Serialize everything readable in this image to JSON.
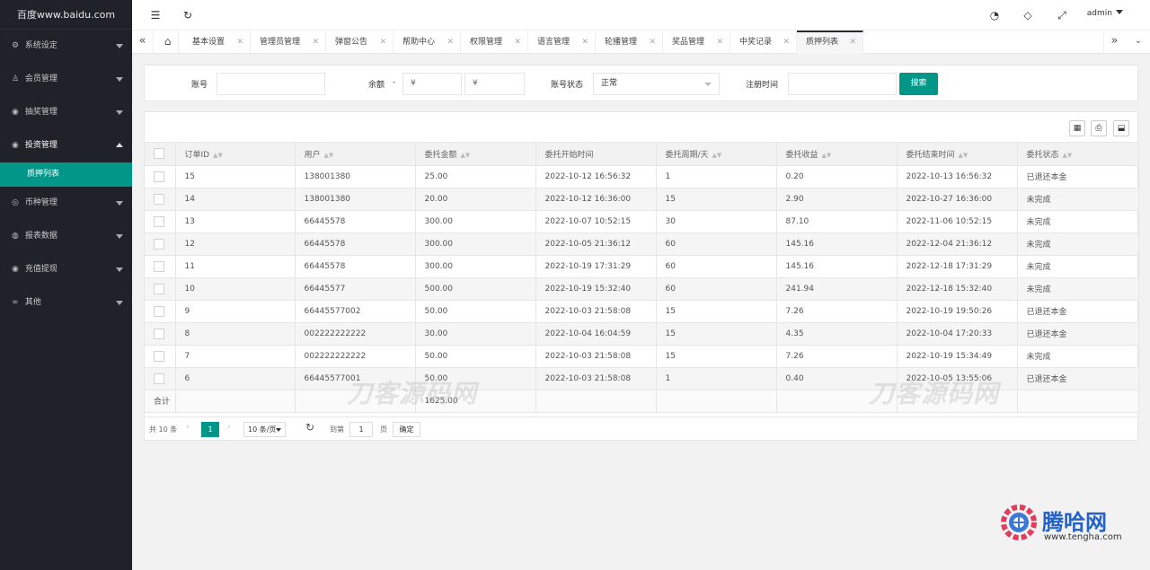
{
  "sidebar": {
    "logo": "百度www.baidu.com",
    "items": [
      {
        "label": "系统设定",
        "icon": "gear-icon"
      },
      {
        "label": "会员管理",
        "icon": "user-icon"
      },
      {
        "label": "抽奖管理",
        "icon": "circle-icon"
      },
      {
        "label": "投资管理",
        "icon": "circle-icon"
      },
      {
        "label": "币种管理",
        "icon": "coin-icon"
      },
      {
        "label": "报表数据",
        "icon": "report-icon"
      },
      {
        "label": "充值提现",
        "icon": "money-icon"
      },
      {
        "label": "其他",
        "icon": "infinity-icon"
      }
    ],
    "submenu": {
      "label": "质押列表"
    }
  },
  "header": {
    "user": "admin"
  },
  "tabs": [
    {
      "label": "基本设置"
    },
    {
      "label": "管理员管理"
    },
    {
      "label": "弹窗公告"
    },
    {
      "label": "帮助中心"
    },
    {
      "label": "权限管理"
    },
    {
      "label": "语言管理"
    },
    {
      "label": "轮播管理"
    },
    {
      "label": "奖品管理"
    },
    {
      "label": "中奖记录"
    },
    {
      "label": "质押列表"
    }
  ],
  "search": {
    "account_label": "账号",
    "balance_label": "余额",
    "dash": "-",
    "min_placeholder": "¥",
    "max_placeholder": "¥",
    "status_label": "账号状态",
    "status_value": "正常",
    "register_label": "注册时间",
    "search_button": "搜索"
  },
  "table": {
    "columns": [
      "订单ID",
      "用户",
      "委托金额",
      "委托开始时间",
      "委托周期/天",
      "委托收益",
      "委托结束时间",
      "委托状态"
    ],
    "rows": [
      [
        "15",
        "138001380",
        "25.00",
        "2022-10-12 16:56:32",
        "1",
        "0.20",
        "2022-10-13 16:56:32",
        "已退还本金"
      ],
      [
        "14",
        "138001380",
        "20.00",
        "2022-10-12 16:36:00",
        "15",
        "2.90",
        "2022-10-27 16:36:00",
        "未完成"
      ],
      [
        "13",
        "66445578",
        "300.00",
        "2022-10-07 10:52:15",
        "30",
        "87.10",
        "2022-11-06 10:52:15",
        "未完成"
      ],
      [
        "12",
        "66445578",
        "300.00",
        "2022-10-05 21:36:12",
        "60",
        "145.16",
        "2022-12-04 21:36:12",
        "未完成"
      ],
      [
        "11",
        "66445578",
        "300.00",
        "2022-10-19 17:31:29",
        "60",
        "145.16",
        "2022-12-18 17:31:29",
        "未完成"
      ],
      [
        "10",
        "66445577",
        "500.00",
        "2022-10-19 15:32:40",
        "60",
        "241.94",
        "2022-12-18 15:32:40",
        "未完成"
      ],
      [
        "9",
        "66445577002",
        "50.00",
        "2022-10-03 21:58:08",
        "15",
        "7.26",
        "2022-10-19 19:50:26",
        "已退还本金"
      ],
      [
        "8",
        "002222222222",
        "30.00",
        "2022-10-04 16:04:59",
        "15",
        "4.35",
        "2022-10-04 17:20:33",
        "已退还本金"
      ],
      [
        "7",
        "002222222222",
        "50.00",
        "2022-10-03 21:58:08",
        "15",
        "7.26",
        "2022-10-19 15:34:49",
        "未完成"
      ],
      [
        "6",
        "66445577001",
        "50.00",
        "2022-10-03 21:58:08",
        "1",
        "0.40",
        "2022-10-05 13:55:06",
        "已退还本金"
      ]
    ],
    "sum_label": "合计",
    "sum_value": "1625.00"
  },
  "pager": {
    "total": "共 10 条",
    "current": "1",
    "page_size": "10 条/页",
    "goto_label": "到第",
    "goto_value": "1",
    "page_unit": "页",
    "confirm": "确定"
  },
  "watermark": "刀客源码网",
  "brand": {
    "name": "腾哈网",
    "url": "www.tengha.com",
    "color": "#2462c7"
  },
  "colors": {
    "accent": "#009688",
    "sidebar_bg": "#20222a"
  }
}
